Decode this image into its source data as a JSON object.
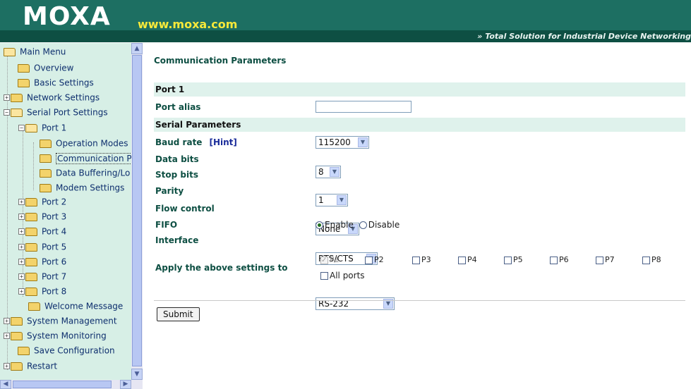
{
  "header": {
    "logo": "MOXA",
    "url": "www.moxa.com",
    "tagline_prefix": "»",
    "tagline": "Total Solution for Industrial Device Networking"
  },
  "sidebar": {
    "items": [
      {
        "label": "Main Menu"
      },
      {
        "label": "Overview"
      },
      {
        "label": "Basic Settings"
      },
      {
        "label": "Network Settings"
      },
      {
        "label": "Serial Port Settings"
      },
      {
        "label": "Port 1"
      },
      {
        "label": "Operation Modes"
      },
      {
        "label": "Communication P."
      },
      {
        "label": "Data Buffering/Lo"
      },
      {
        "label": "Modem Settings"
      },
      {
        "label": "Port 2"
      },
      {
        "label": "Port 3"
      },
      {
        "label": "Port 4"
      },
      {
        "label": "Port 5"
      },
      {
        "label": "Port 6"
      },
      {
        "label": "Port 7"
      },
      {
        "label": "Port 8"
      },
      {
        "label": "Welcome Message"
      },
      {
        "label": "System Management"
      },
      {
        "label": "System Monitoring"
      },
      {
        "label": "Save Configuration"
      },
      {
        "label": "Restart"
      }
    ]
  },
  "main": {
    "title": "Communication Parameters",
    "port_section": "Port 1",
    "port_alias_label": "Port alias",
    "port_alias_value": "",
    "serial_section": "Serial Parameters",
    "baud_rate_label": "Baud rate",
    "hint_label": "[Hint]",
    "baud_rate_value": "115200",
    "data_bits_label": "Data bits",
    "data_bits_value": "8",
    "stop_bits_label": "Stop bits",
    "stop_bits_value": "1",
    "parity_label": "Parity",
    "parity_value": "None",
    "flow_control_label": "Flow control",
    "flow_control_value": "RTS/CTS",
    "fifo_label": "FIFO",
    "fifo_enable": "Enable",
    "fifo_disable": "Disable",
    "interface_label": "Interface",
    "interface_value": "RS-232",
    "apply_label": "Apply the above settings to",
    "ports": [
      "P1",
      "P2",
      "P3",
      "P4",
      "P5",
      "P6",
      "P7",
      "P8"
    ],
    "all_ports": "All ports",
    "submit": "Submit"
  }
}
